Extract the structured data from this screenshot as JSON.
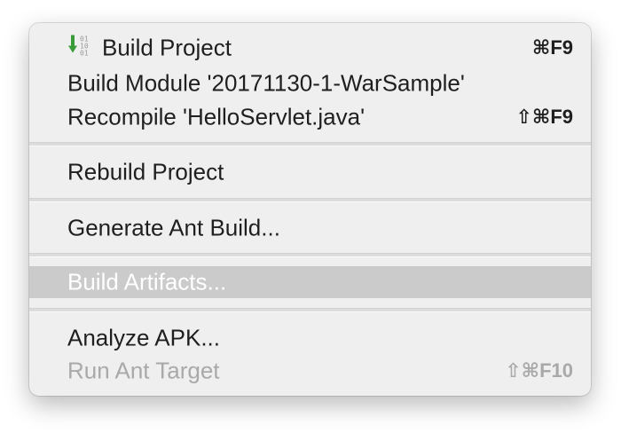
{
  "menu": {
    "items": [
      {
        "label": "Build Project",
        "shortcut": "⌘F9",
        "icon": "build-icon",
        "enabled": true
      },
      {
        "label": "Build Module '20171130-1-WarSample'",
        "shortcut": "",
        "enabled": true
      },
      {
        "label": "Recompile 'HelloServlet.java'",
        "shortcut": "⇧⌘F9",
        "enabled": true
      },
      {
        "label": "Rebuild Project",
        "shortcut": "",
        "enabled": true
      },
      {
        "label": "Generate Ant Build...",
        "shortcut": "",
        "enabled": true
      },
      {
        "label": "Build Artifacts...",
        "shortcut": "",
        "enabled": true,
        "selected": true
      },
      {
        "label": "Analyze APK...",
        "shortcut": "",
        "enabled": true
      },
      {
        "label": "Run Ant Target",
        "shortcut": "⇧⌘F10",
        "enabled": false
      }
    ]
  },
  "colors": {
    "menu_background": "#efefef",
    "selected_background": "#cbcbcb",
    "disabled_text": "#a9a9a9",
    "icon_green": "#3a9b3a"
  }
}
